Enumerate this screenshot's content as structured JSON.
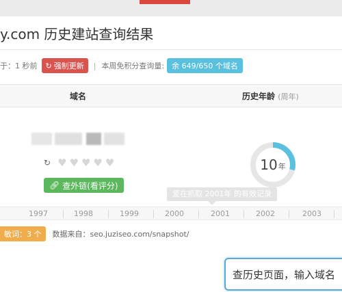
{
  "header": {
    "title": "y.com 历史建站查询结果"
  },
  "meta": {
    "updated_text": "于：1 秒前",
    "refresh_button": "强制更新",
    "separator": "|",
    "quota_label": "本周免积分查询量:",
    "quota_value": "余 649/650 个域名"
  },
  "table": {
    "col_domain": "域名",
    "col_age": "历史年龄",
    "col_age_unit": "(周年)"
  },
  "result": {
    "rating_count": 5,
    "links_button": "查外链(看评分)",
    "age_value": "10",
    "age_unit": "年",
    "age_fraction": 0.29,
    "tooltip": "爱在抓取 2001年 的有效记录"
  },
  "timeline": {
    "years": [
      "1997",
      "1998",
      "1999",
      "2000",
      "2001",
      "2002",
      "2003"
    ]
  },
  "footer": {
    "keyword_badge": "敏词：3 个",
    "source_text": "数据来自：seo.juziseo.com/snapshot/"
  },
  "search": {
    "text": "查历史页面，输入域名"
  },
  "colors": {
    "accent_red": "#d9534f",
    "accent_blue": "#5bc0de",
    "accent_green": "#5cb85c",
    "accent_orange": "#f0ad4e"
  }
}
